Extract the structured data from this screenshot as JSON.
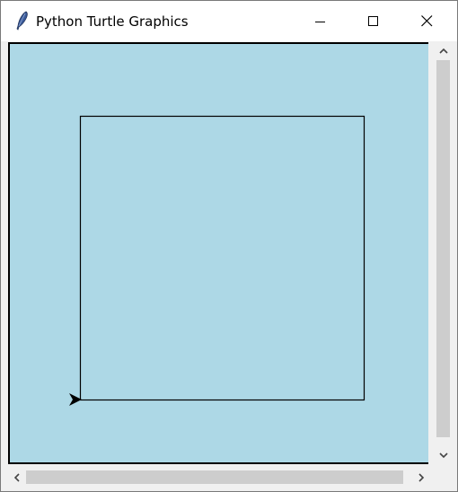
{
  "window": {
    "title": "Python Turtle Graphics"
  },
  "canvas": {
    "background": "#add8e6",
    "stroke": "#000000",
    "shape": "square",
    "turtle_heading": "east"
  },
  "icons": {
    "app": "feather-icon",
    "minimize": "minimize-icon",
    "maximize": "maximize-icon",
    "close": "close-icon",
    "scroll_up": "chevron-up-icon",
    "scroll_down": "chevron-down-icon",
    "scroll_left": "chevron-left-icon",
    "scroll_right": "chevron-right-icon"
  }
}
